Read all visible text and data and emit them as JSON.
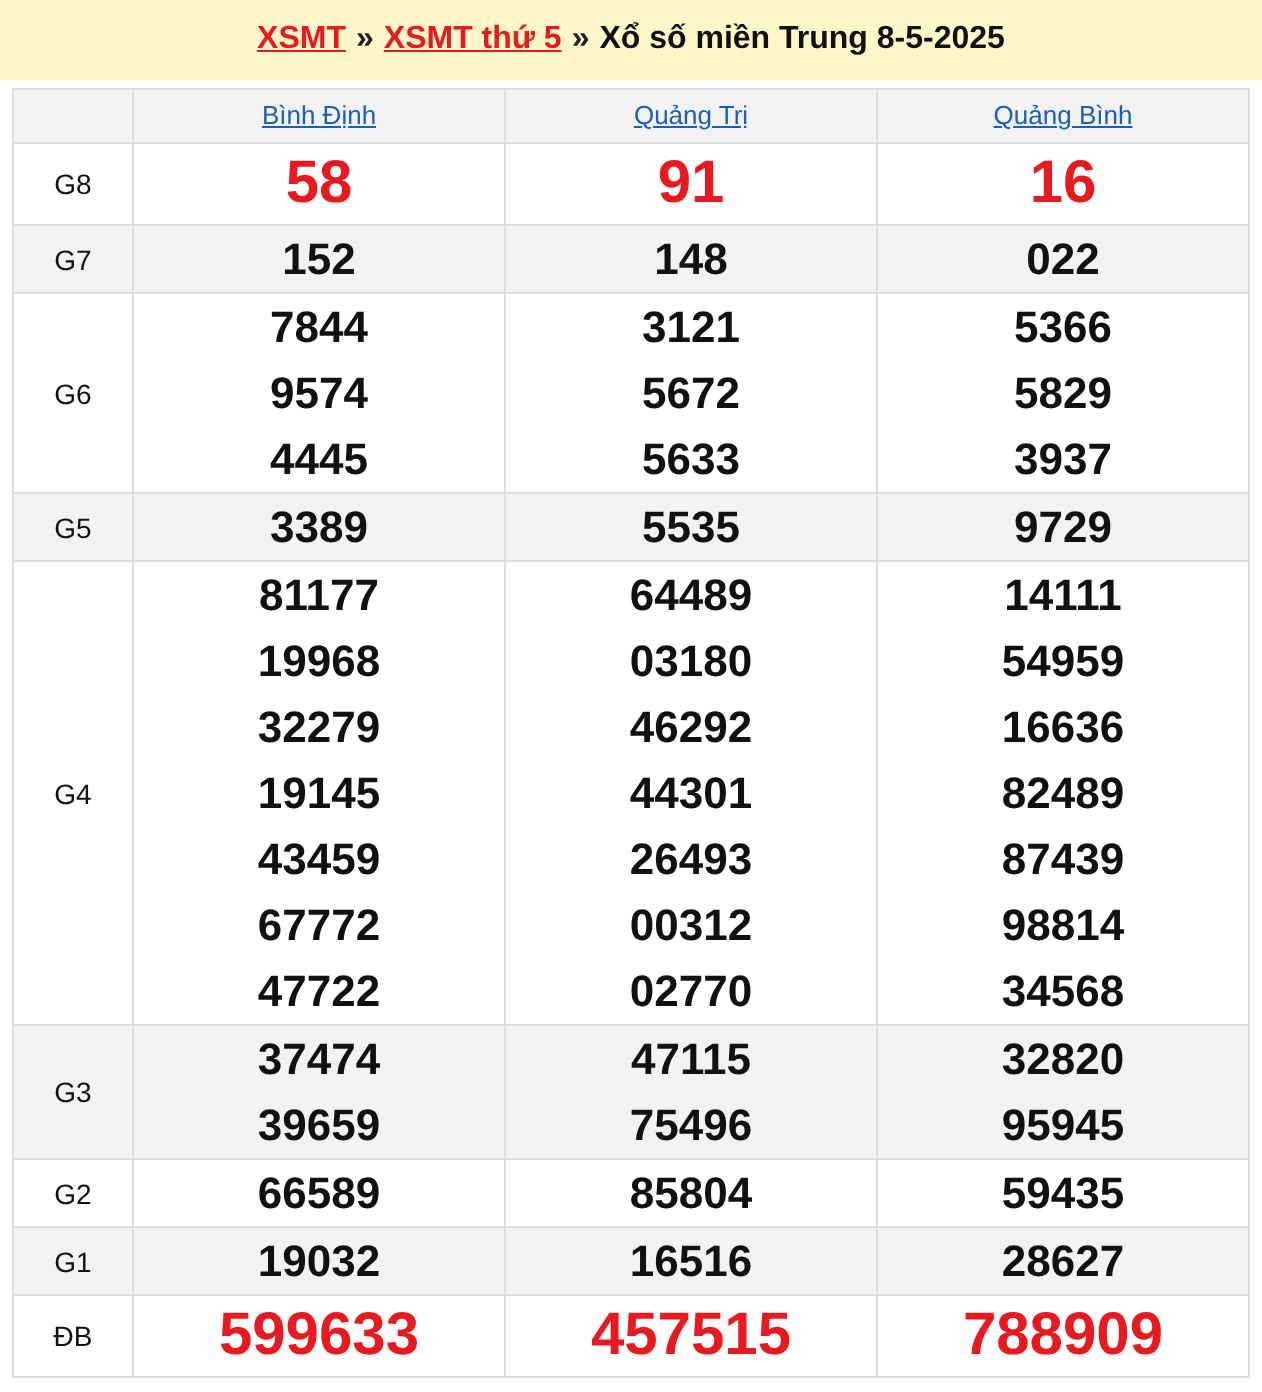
{
  "breadcrumb": {
    "links": [
      "XSMT",
      "XSMT thứ 5"
    ],
    "separator": "»",
    "title": "Xổ số miền Trung 8-5-2025"
  },
  "provinces": [
    "Bình Định",
    "Quảng Trị",
    "Quảng Bình"
  ],
  "prizes": [
    {
      "label": "G8",
      "kind": "highlight",
      "results": [
        [
          "58"
        ],
        [
          "91"
        ],
        [
          "16"
        ]
      ]
    },
    {
      "label": "G7",
      "kind": "normal",
      "results": [
        [
          "152"
        ],
        [
          "148"
        ],
        [
          "022"
        ]
      ]
    },
    {
      "label": "G6",
      "kind": "normal",
      "results": [
        [
          "7844",
          "9574",
          "4445"
        ],
        [
          "3121",
          "5672",
          "5633"
        ],
        [
          "5366",
          "5829",
          "3937"
        ]
      ]
    },
    {
      "label": "G5",
      "kind": "normal",
      "results": [
        [
          "3389"
        ],
        [
          "5535"
        ],
        [
          "9729"
        ]
      ]
    },
    {
      "label": "G4",
      "kind": "normal",
      "results": [
        [
          "81177",
          "19968",
          "32279",
          "19145",
          "43459",
          "67772",
          "47722"
        ],
        [
          "64489",
          "03180",
          "46292",
          "44301",
          "26493",
          "00312",
          "02770"
        ],
        [
          "14111",
          "54959",
          "16636",
          "82489",
          "87439",
          "98814",
          "34568"
        ]
      ]
    },
    {
      "label": "G3",
      "kind": "normal",
      "results": [
        [
          "37474",
          "39659"
        ],
        [
          "47115",
          "75496"
        ],
        [
          "32820",
          "95945"
        ]
      ]
    },
    {
      "label": "G2",
      "kind": "normal",
      "results": [
        [
          "66589"
        ],
        [
          "85804"
        ],
        [
          "59435"
        ]
      ]
    },
    {
      "label": "G1",
      "kind": "normal",
      "results": [
        [
          "19032"
        ],
        [
          "16516"
        ],
        [
          "28627"
        ]
      ]
    },
    {
      "label": "ĐB",
      "kind": "highlight",
      "results": [
        [
          "599633"
        ],
        [
          "457515"
        ],
        [
          "788909"
        ]
      ]
    }
  ]
}
